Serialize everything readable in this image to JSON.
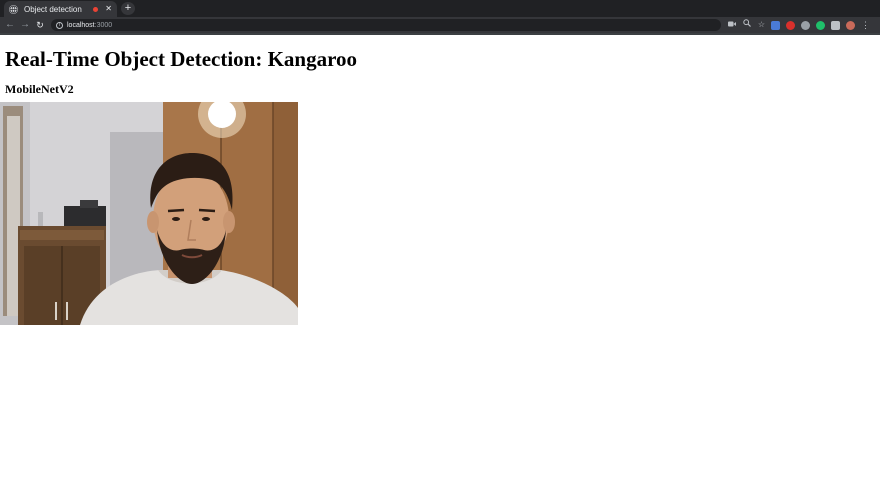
{
  "browser": {
    "tab": {
      "title": "Object detection",
      "close_glyph": "✕"
    },
    "new_tab_glyph": "+",
    "nav": {
      "back_glyph": "←",
      "forward_glyph": "→",
      "reload_glyph": "↻"
    },
    "address": {
      "host": "localhost",
      "port": ":3000"
    },
    "toolbar_icons": [
      "camera-icon",
      "zoom-icon",
      "bookmark-star-icon"
    ],
    "extension_icons": [
      {
        "name": "translate-extension-icon",
        "color": "#4a7bd6"
      },
      {
        "name": "adblock-extension-icon",
        "color": "#d9302c"
      },
      {
        "name": "incognito-extension-icon",
        "color": "#9aa0a6"
      },
      {
        "name": "green-extension-icon",
        "color": "#1fbf6a"
      },
      {
        "name": "puzzle-extensions-icon",
        "color": "#bdc1c6"
      },
      {
        "name": "profile-avatar-icon",
        "color": "#c96a5a"
      }
    ],
    "menu_glyph": "⋮"
  },
  "page": {
    "title": "Real-Time Object Detection: Kangaroo",
    "model": "MobileNetV2",
    "webcam": {
      "content": "webcam-video-feed"
    }
  }
}
